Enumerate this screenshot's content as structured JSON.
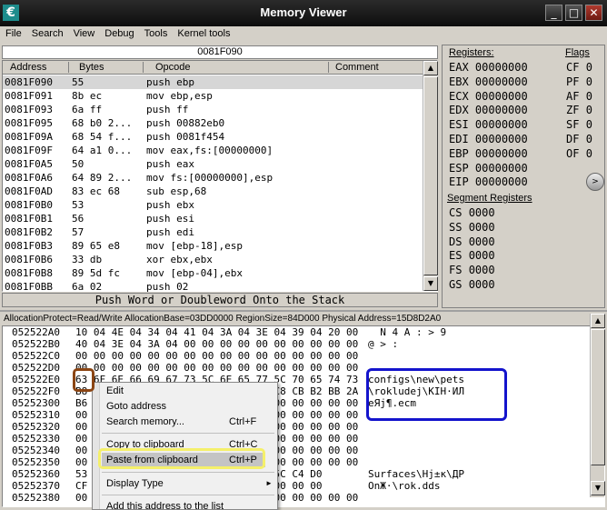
{
  "window": {
    "title": "Memory Viewer",
    "app_icon": "cheat-engine-icon",
    "controls": [
      "_",
      "□",
      "✕"
    ]
  },
  "menu": [
    "File",
    "Search",
    "View",
    "Debug",
    "Tools",
    "Kernel tools"
  ],
  "disassembler": {
    "address_bar": "0081F090",
    "columns": [
      "Address",
      "Bytes",
      "Opcode",
      "Comment"
    ],
    "rows": [
      {
        "addr": "0081F090",
        "bytes": "55",
        "op": "push ebp"
      },
      {
        "addr": "0081F091",
        "bytes": "8b ec",
        "op": "mov ebp,esp"
      },
      {
        "addr": "0081F093",
        "bytes": "6a ff",
        "op": "push ff"
      },
      {
        "addr": "0081F095",
        "bytes": "68 b0 2...",
        "op": "push 00882eb0"
      },
      {
        "addr": "0081F09A",
        "bytes": "68 54 f...",
        "op": "push 0081f454"
      },
      {
        "addr": "0081F09F",
        "bytes": "64 a1 0...",
        "op": "mov eax,fs:[00000000]"
      },
      {
        "addr": "0081F0A5",
        "bytes": "50",
        "op": "push eax"
      },
      {
        "addr": "0081F0A6",
        "bytes": "64 89 2...",
        "op": "mov fs:[00000000],esp"
      },
      {
        "addr": "0081F0AD",
        "bytes": "83 ec 68",
        "op": "sub esp,68"
      },
      {
        "addr": "0081F0B0",
        "bytes": "53",
        "op": "push ebx"
      },
      {
        "addr": "0081F0B1",
        "bytes": "56",
        "op": "push esi"
      },
      {
        "addr": "0081F0B2",
        "bytes": "57",
        "op": "push edi"
      },
      {
        "addr": "0081F0B3",
        "bytes": "89 65 e8",
        "op": "mov [ebp-18],esp"
      },
      {
        "addr": "0081F0B6",
        "bytes": "33 db",
        "op": "xor ebx,ebx"
      },
      {
        "addr": "0081F0B8",
        "bytes": "89 5d fc",
        "op": "mov [ebp-04],ebx"
      },
      {
        "addr": "0081F0BB",
        "bytes": "6a 02",
        "op": "push 02"
      }
    ],
    "description": "Push Word or Doubleword Onto the Stack"
  },
  "registers": {
    "label": "Registers:",
    "flags_label": "Flags",
    "segment_label": "Segment Registers",
    "general": [
      {
        "name": "EAX",
        "value": "00000000"
      },
      {
        "name": "EBX",
        "value": "00000000"
      },
      {
        "name": "ECX",
        "value": "00000000"
      },
      {
        "name": "EDX",
        "value": "00000000"
      },
      {
        "name": "ESI",
        "value": "00000000"
      },
      {
        "name": "EDI",
        "value": "00000000"
      },
      {
        "name": "EBP",
        "value": "00000000"
      },
      {
        "name": "ESP",
        "value": "00000000"
      },
      {
        "name": "EIP",
        "value": "00000000"
      }
    ],
    "flags": [
      {
        "name": "CF",
        "value": "0"
      },
      {
        "name": "PF",
        "value": "0"
      },
      {
        "name": "AF",
        "value": "0"
      },
      {
        "name": "ZF",
        "value": "0"
      },
      {
        "name": "SF",
        "value": "0"
      },
      {
        "name": "DF",
        "value": "0"
      },
      {
        "name": "OF",
        "value": "0"
      }
    ],
    "segments": [
      {
        "name": "CS",
        "value": "0000"
      },
      {
        "name": "SS",
        "value": "0000"
      },
      {
        "name": "DS",
        "value": "0000"
      },
      {
        "name": "ES",
        "value": "0000"
      },
      {
        "name": "FS",
        "value": "0000"
      },
      {
        "name": "GS",
        "value": "0000"
      }
    ]
  },
  "hexview": {
    "info": "AllocationProtect=Read/Write  AllocationBase=03DD0000 RegionSize=84D000 Physical Address=15D8D2A0",
    "rows": [
      {
        "addr": "052522A0",
        "bytes": "10 04 4E 04 34 04 41 04 3A 04 3E 04 39 04 20 00",
        "ascii": "  N 4 A : > 9"
      },
      {
        "addr": "052522B0",
        "bytes": "40 04 3E 04 3A 04 00 00 00 00 00 00 00 00 00 00",
        "ascii": "@ > :"
      },
      {
        "addr": "052522C0",
        "bytes": "00 00 00 00 00 00 00 00 00 00 00 00 00 00 00 00",
        "ascii": ""
      },
      {
        "addr": "052522D0",
        "bytes": "00 00 00 00 00 00 00 00 00 00 00 00 00 00 00 00",
        "ascii": ""
      },
      {
        "addr": "052522E0",
        "bytes": "63 6F 6E 66 69 67 73 5C 6E 65 77 5C 70 65 74 73",
        "ascii": "configs\\new\\pets"
      },
      {
        "addr": "052522F0",
        "bytes": "B8 E1 AE 3E 3A 20 AE 25 AF CD B7 C8 CB B2 BB 2A",
        "ascii": "\\rokludej\\КІН·ИЛ"
      },
      {
        "addr": "05252300",
        "bytes": "B6 32 00 00 00 00 00 00 00 00 00 00 00 00 00 00",
        "ascii": "еЯј¶.ecm"
      },
      {
        "addr": "05252310",
        "bytes": "00 00 00 00 00 00 00 00 00 00 00 00 00 00 00 00",
        "ascii": ""
      },
      {
        "addr": "05252320",
        "bytes": "00 00 00 00 00 00 00 00 00 00 00 00 00 00 00 00",
        "ascii": ""
      },
      {
        "addr": "05252330",
        "bytes": "00 00 00 00 00 00 00 00 00 00 00 00 00 00 00 00",
        "ascii": ""
      },
      {
        "addr": "05252340",
        "bytes": "00 00 00 00 00 00 00 00 00 00 00 00 00 00 00 00",
        "ascii": ""
      },
      {
        "addr": "05252350",
        "bytes": "00 00 00 00 00 00 00 00 00 00 00 00 00 00 00 00",
        "ascii": ""
      },
      {
        "addr": "05252360",
        "bytes": "53 75 72 66 61 63 65 73 5C B1 EA 5C C4 D0",
        "ascii": "Surfaces\\Нј±к\\ДР"
      },
      {
        "addr": "05252370",
        "bytes": "CF 2E 00 00 00 00 00 00 00 73 00 00 00 00",
        "ascii": "ОnЖ·\\rok.dds"
      },
      {
        "addr": "05252380",
        "bytes": "00 00 00 00 00 00 00 00 00 00 00 00 00 00 00 00",
        "ascii": ""
      }
    ]
  },
  "context_menu": [
    {
      "label": "Edit",
      "shortcut": ""
    },
    {
      "label": "Goto address",
      "shortcut": ""
    },
    {
      "label": "Search memory...",
      "shortcut": "Ctrl+F"
    },
    {
      "label": "Copy to clipboard",
      "shortcut": "Ctrl+C"
    },
    {
      "label": "Paste from clipboard",
      "shortcut": "Ctrl+P"
    },
    {
      "label": "Display Type",
      "shortcut": "►"
    },
    {
      "label": "Add this address to the list",
      "shortcut": ""
    }
  ]
}
